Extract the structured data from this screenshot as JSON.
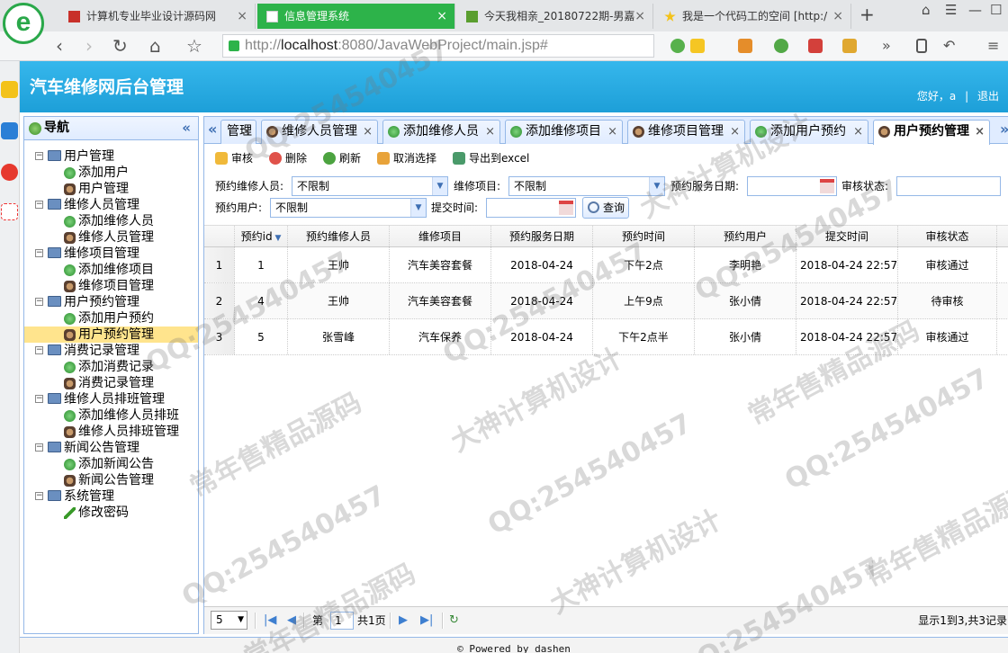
{
  "browser": {
    "tabs": [
      {
        "label": "计算机专业毕业设计源码网"
      },
      {
        "label": "信息管理系统"
      },
      {
        "label": "今天我相亲_20180722期-男嘉"
      },
      {
        "label": "我是一个代码工的空间 [http:/"
      }
    ],
    "new_tab": "+",
    "url_prefix": "http://",
    "url_host": "localhost",
    "url_rest": ":8080/JavaWebProject/main.jsp#"
  },
  "app": {
    "title": "汽车维修网后台管理",
    "greeting": "您好，a",
    "separator": "|",
    "logout": "退出"
  },
  "nav": {
    "title": "导航",
    "collapse": "«",
    "groups": [
      {
        "label": "用户管理",
        "items": [
          {
            "label": "添加用户",
            "icon": "add"
          },
          {
            "label": "用户管理",
            "icon": "user"
          }
        ]
      },
      {
        "label": "维修人员管理",
        "items": [
          {
            "label": "添加维修人员",
            "icon": "add"
          },
          {
            "label": "维修人员管理",
            "icon": "user"
          }
        ]
      },
      {
        "label": "维修项目管理",
        "items": [
          {
            "label": "添加维修项目",
            "icon": "add"
          },
          {
            "label": "维修项目管理",
            "icon": "user"
          }
        ]
      },
      {
        "label": "用户预约管理",
        "items": [
          {
            "label": "添加用户预约",
            "icon": "add"
          },
          {
            "label": "用户预约管理",
            "icon": "user",
            "selected": true
          }
        ]
      },
      {
        "label": "消费记录管理",
        "items": [
          {
            "label": "添加消费记录",
            "icon": "add"
          },
          {
            "label": "消费记录管理",
            "icon": "user"
          }
        ]
      },
      {
        "label": "维修人员排班管理",
        "items": [
          {
            "label": "添加维修人员排班",
            "icon": "add"
          },
          {
            "label": "维修人员排班管理",
            "icon": "user"
          }
        ]
      },
      {
        "label": "新闻公告管理",
        "items": [
          {
            "label": "添加新闻公告",
            "icon": "add"
          },
          {
            "label": "新闻公告管理",
            "icon": "user"
          }
        ]
      },
      {
        "label": "系统管理",
        "items": [
          {
            "label": "修改密码",
            "icon": "pen"
          }
        ]
      }
    ]
  },
  "tabs": {
    "left_scroll": "«",
    "right_scroll": "»",
    "items": [
      {
        "label": "管理",
        "icon": "none"
      },
      {
        "label": "维修人员管理",
        "icon": "user"
      },
      {
        "label": "添加维修人员",
        "icon": "add"
      },
      {
        "label": "添加维修项目",
        "icon": "add"
      },
      {
        "label": "维修项目管理",
        "icon": "user"
      },
      {
        "label": "添加用户预约",
        "icon": "add"
      },
      {
        "label": "用户预约管理",
        "icon": "user",
        "active": true
      }
    ],
    "close": "×"
  },
  "toolbar": {
    "audit": "审核",
    "delete": "删除",
    "refresh": "刷新",
    "unselect": "取消选择",
    "export": "导出到excel"
  },
  "filter": {
    "worker_label": "预约维修人员:",
    "worker_value": "不限制",
    "project_label": "维修项目:",
    "project_value": "不限制",
    "date_label": "预约服务日期:",
    "status_label": "审核状态:",
    "user_label": "预约用户:",
    "user_value": "不限制",
    "submit_label": "提交时间:",
    "query": "查询"
  },
  "grid": {
    "columns": [
      "预约id",
      "预约维修人员",
      "维修项目",
      "预约服务日期",
      "预约时间",
      "预约用户",
      "提交时间",
      "审核状态"
    ],
    "rows": [
      {
        "n": "1",
        "id": "1",
        "worker": "王帅",
        "project": "汽车美容套餐",
        "date": "2018-04-24",
        "time": "下午2点",
        "user": "李明艳",
        "submit": "2018-04-24 22:57:",
        "status": "审核通过"
      },
      {
        "n": "2",
        "id": "4",
        "worker": "王帅",
        "project": "汽车美容套餐",
        "date": "2018-04-24",
        "time": "上午9点",
        "user": "张小倩",
        "submit": "2018-04-24 22:57:",
        "status": "待审核"
      },
      {
        "n": "3",
        "id": "5",
        "worker": "张雪峰",
        "project": "汽车保养",
        "date": "2018-04-24",
        "time": "下午2点半",
        "user": "张小倩",
        "submit": "2018-04-24 22:57:",
        "status": "审核通过"
      }
    ]
  },
  "pager": {
    "page_size": "5",
    "page_prefix": "第",
    "page_value": "1",
    "page_suffix": "共1页",
    "summary": "显示1到3,共3记录"
  },
  "footer": "© Powered by dashen",
  "watermarks": [
    "QQ:254540457",
    "常年售精品源码",
    "大神计算机设计"
  ],
  "colors": {
    "header": "#1d9fd8",
    "panel_border": "#95b8e7",
    "tab_active": "#2db34a",
    "selected_row": "#ffe48d"
  }
}
